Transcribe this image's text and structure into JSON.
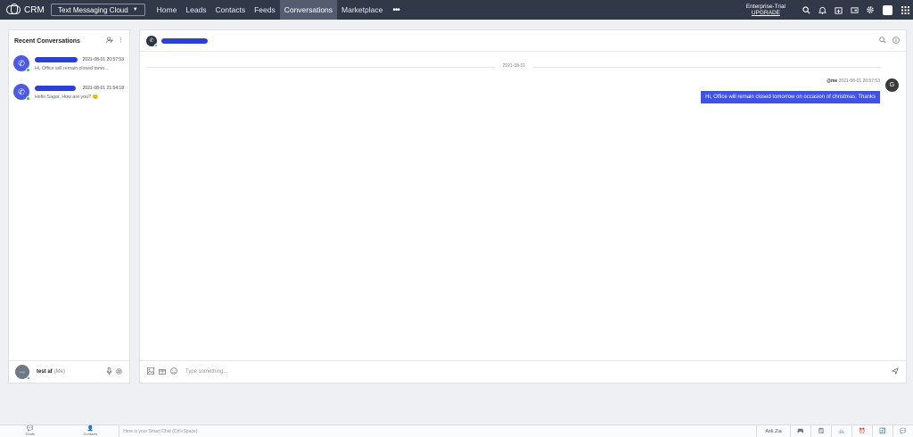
{
  "topbar": {
    "brand": "CRM",
    "app_name": "Text Messaging Cloud",
    "nav": [
      "Home",
      "Leads",
      "Contacts",
      "Feeds",
      "Conversations",
      "Marketplace"
    ],
    "active_nav": "Conversations",
    "more": "•••",
    "plan": "Enterprise-Trial",
    "upgrade": "UPGRADE"
  },
  "left_panel": {
    "title": "Recent Conversations",
    "conversations": [
      {
        "time": "2021-08-01 20:57:53",
        "preview": "Hi, Office will remain closed tomo..."
      },
      {
        "time": "2021-08-01 21:54:18",
        "preview": "Hello Sagar, How are you? 😊"
      }
    ],
    "me": {
      "avatar_text": "Logo",
      "name": "test af",
      "tag": "(Me)"
    }
  },
  "chat": {
    "date": "2021-08-01",
    "message": {
      "sender_label": "@me",
      "time": "2021-08-01 20:57:53",
      "text": "Hi, Office will remain closed tomorrow on occasion of christmas. Thanks",
      "avatar": "G"
    },
    "placeholder": "Type something..."
  },
  "bottombar": {
    "chats": "Chats",
    "contacts": "Contacts",
    "smart_chat": "Here is your Smart Chat (Ctrl+Space)",
    "ask_zia": "Ask Zia"
  },
  "colors": {
    "nav_bg": "#313949",
    "accent": "#3f51e6",
    "online": "#3fb950",
    "redaction": "#2c3fd6"
  }
}
